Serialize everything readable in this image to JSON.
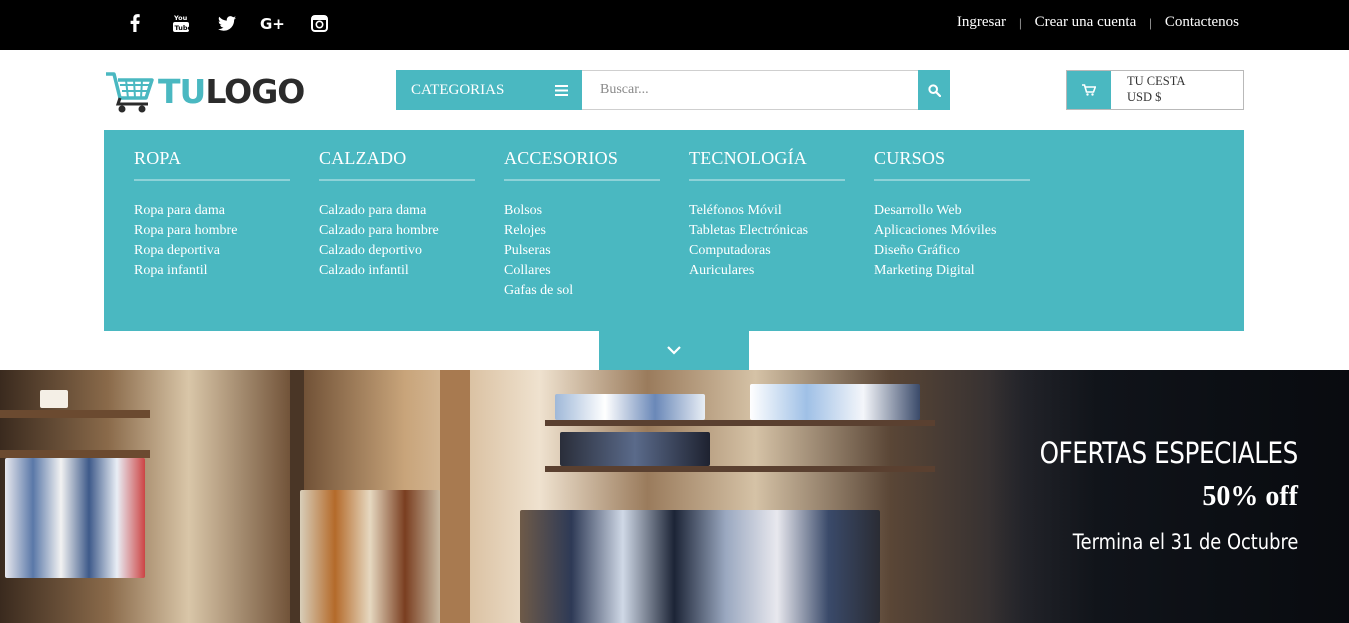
{
  "topbar": {
    "social": [
      {
        "name": "facebook-icon",
        "glyph": "f"
      },
      {
        "name": "youtube-icon",
        "glyph": "You Tube"
      },
      {
        "name": "twitter-icon",
        "glyph": "bird"
      },
      {
        "name": "google-plus-icon",
        "glyph": "G+"
      },
      {
        "name": "instagram-icon",
        "glyph": "camera"
      }
    ],
    "links": {
      "login": "Ingresar",
      "register": "Crear una cuenta",
      "contact": "Contactenos",
      "separator": "|"
    }
  },
  "header": {
    "logo_tu": "TU",
    "logo_rest": "LOGO",
    "categories_label": "CATEGORIAS",
    "search_placeholder": "Buscar...",
    "cart_line1": "TU CESTA",
    "cart_line2": "USD $"
  },
  "menu": {
    "columns": [
      {
        "title": "ROPA",
        "items": [
          "Ropa para dama",
          "Ropa para hombre",
          "Ropa deportiva",
          "Ropa infantil"
        ]
      },
      {
        "title": "CALZADO",
        "items": [
          "Calzado para dama",
          "Calzado para hombre",
          "Calzado deportivo",
          "Calzado infantil"
        ]
      },
      {
        "title": "ACCESORIOS",
        "items": [
          "Bolsos",
          "Relojes",
          "Pulseras",
          "Collares",
          "Gafas de sol"
        ]
      },
      {
        "title": "TECNOLOGÍA",
        "items": [
          "Teléfonos Móvil",
          "Tabletas Electrónicas",
          "Computadoras",
          "Auriculares"
        ]
      },
      {
        "title": "CURSOS",
        "items": [
          "Desarrollo Web",
          "Aplicaciones Móviles",
          "Diseño Gráfico",
          "Marketing Digital"
        ]
      }
    ]
  },
  "banner": {
    "title": "OFERTAS ESPECIALES",
    "discount": "50% off",
    "ends": "Termina el 31 de Octubre"
  },
  "colors": {
    "accent": "#4ab8c1",
    "topbar": "#000000"
  }
}
